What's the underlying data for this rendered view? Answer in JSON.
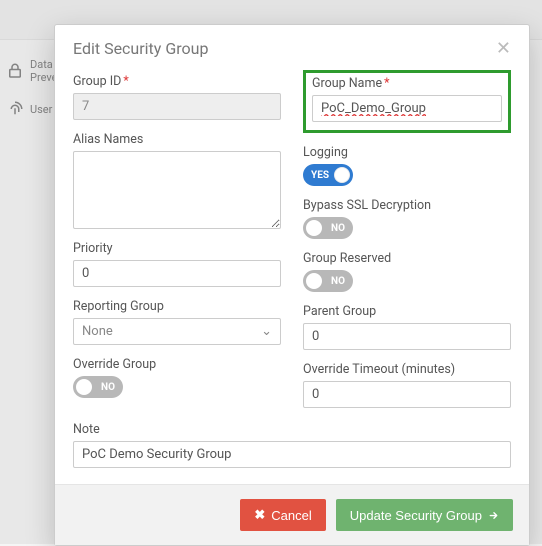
{
  "bg": {
    "item1": "Data Loss Prevention",
    "item2": "User"
  },
  "modal": {
    "title": "Edit Security Group",
    "group_id": {
      "label": "Group ID",
      "value": "7"
    },
    "group_name": {
      "label": "Group Name",
      "value": "PoC_Demo_Group"
    },
    "alias": {
      "label": "Alias Names",
      "value": ""
    },
    "logging": {
      "label": "Logging",
      "on_text": "YES"
    },
    "bypass": {
      "label": "Bypass SSL Decryption",
      "off_text": "NO"
    },
    "priority": {
      "label": "Priority",
      "value": "0"
    },
    "reserved": {
      "label": "Group Reserved",
      "off_text": "NO"
    },
    "reporting": {
      "label": "Reporting Group",
      "value": "None"
    },
    "parent": {
      "label": "Parent Group",
      "value": "0"
    },
    "override_group": {
      "label": "Override Group",
      "off_text": "NO"
    },
    "override_timeout": {
      "label": "Override Timeout (minutes)",
      "value": "0"
    },
    "note": {
      "label": "Note",
      "value": "PoC Demo Security Group"
    },
    "cancel": "Cancel",
    "submit": "Update Security Group"
  }
}
